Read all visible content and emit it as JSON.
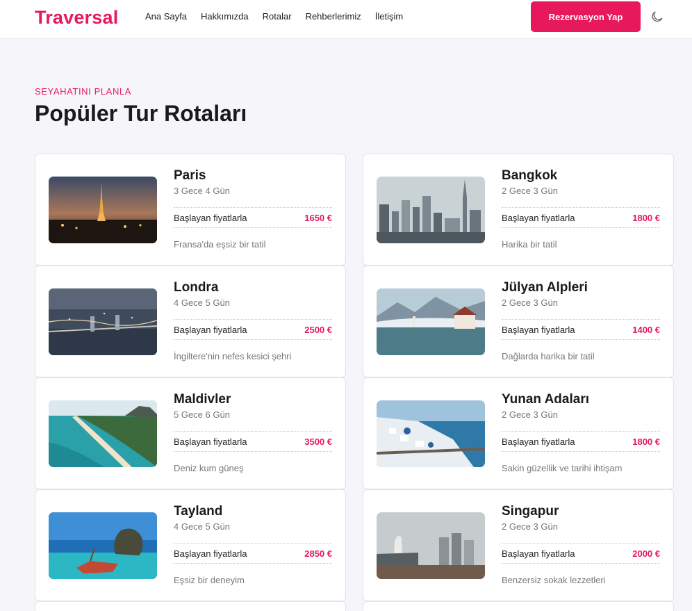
{
  "brand": {
    "name": "Traversal"
  },
  "nav": {
    "links": [
      "Ana Sayfa",
      "Hakkımızda",
      "Rotalar",
      "Rehberlerimiz",
      "İletişim"
    ],
    "cta": "Rezervasyon Yap",
    "theme_icon": "moon-icon"
  },
  "section": {
    "subtitle": "SEYAHATINI PLANLA",
    "title": "Popüler Tur Rotaları"
  },
  "tours": [
    {
      "name": "Paris",
      "duration": "3 Gece 4 Gün",
      "price_label": "Başlayan fiyatlarla",
      "price": "1650 €",
      "desc": "Fransa'da eşsiz bir tatil"
    },
    {
      "name": "Bangkok",
      "duration": "2 Gece 3 Gün",
      "price_label": "Başlayan fiyatlarla",
      "price": "1800 €",
      "desc": "Harika bir tatil"
    },
    {
      "name": "Londra",
      "duration": "4 Gece 5 Gün",
      "price_label": "Başlayan fiyatlarla",
      "price": "2500 €",
      "desc": "İngiltere'nin nefes kesici şehri"
    },
    {
      "name": "Jülyan Alpleri",
      "duration": "2 Gece 3 Gün",
      "price_label": "Başlayan fiyatlarla",
      "price": "1400 €",
      "desc": "Dağlarda harika bir tatil"
    },
    {
      "name": "Maldivler",
      "duration": "5 Gece 6 Gün",
      "price_label": "Başlayan fiyatlarla",
      "price": "3500 €",
      "desc": "Deniz kum güneş"
    },
    {
      "name": "Yunan Adaları",
      "duration": "2 Gece 3 Gün",
      "price_label": "Başlayan fiyatlarla",
      "price": "1800 €",
      "desc": "Sakin güzellik ve tarihi ihtişam"
    },
    {
      "name": "Tayland",
      "duration": "4 Gece 5 Gün",
      "price_label": "Başlayan fiyatlarla",
      "price": "2850 €",
      "desc": "Eşsiz bir deneyim"
    },
    {
      "name": "Singapur",
      "duration": "2 Gece 3 Gün",
      "price_label": "Başlayan fiyatlarla",
      "price": "2000 €",
      "desc": "Benzersiz sokak lezzetleri"
    }
  ],
  "colors": {
    "accent": "#e8185c",
    "background": "#f5f5fa"
  }
}
